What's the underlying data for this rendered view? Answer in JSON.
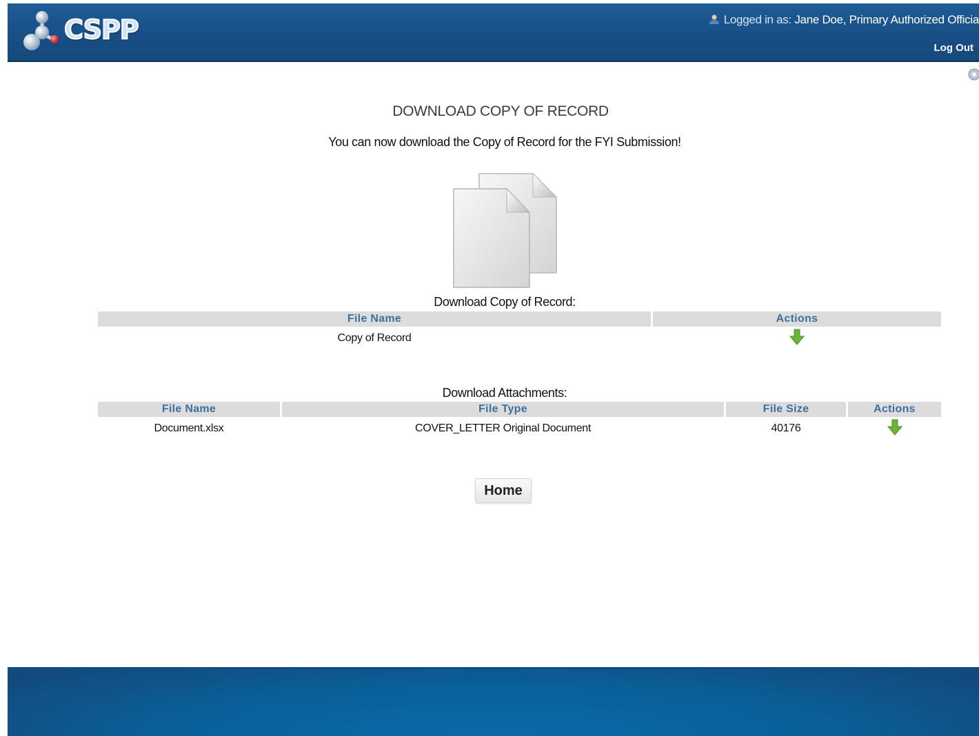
{
  "header": {
    "app_name": "CSPP",
    "logged_in_label": "Logged in as:",
    "user": "Jane Doe, Primary Authorized Officia",
    "logout_label": "Log Out"
  },
  "main": {
    "title": "DOWNLOAD COPY OF RECORD",
    "subtitle": "You can now download the Copy of Record for the FYI Submission!",
    "copy_of_record": {
      "caption": "Download Copy of Record:",
      "columns": [
        "File Name",
        "Actions"
      ],
      "rows": [
        {
          "file_name": "Copy of Record",
          "action_icon": "download-arrow-icon"
        }
      ]
    },
    "attachments": {
      "caption": "Download Attachments:",
      "columns": [
        "File Name",
        "File Type",
        "File Size",
        "Actions"
      ],
      "rows": [
        {
          "file_name": "Document.xlsx",
          "file_type": "COVER_LETTER Original Document",
          "file_size": "40176",
          "action_icon": "download-arrow-icon"
        }
      ]
    },
    "home_label": "Home"
  },
  "icons": {
    "logo": "molecule-logo",
    "user": "user-icon",
    "help": "help-icon",
    "document": "document-copies-icon",
    "download": "download-arrow-icon"
  },
  "colors": {
    "header_bg": "#184f86",
    "footer_bg": "#0a5f98",
    "table_header_bg": "#dcdcdc",
    "table_header_text": "#3f6f9f",
    "download_arrow": "#6bb33a"
  }
}
